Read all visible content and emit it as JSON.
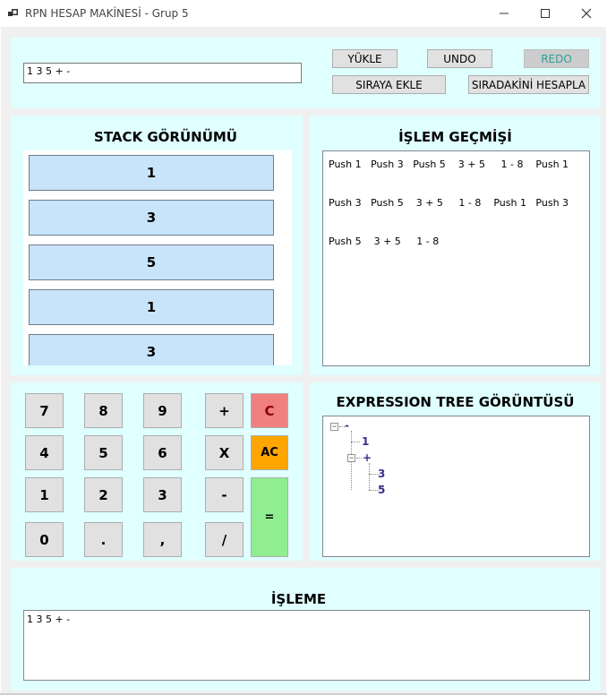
{
  "window": {
    "title": "RPN HESAP MAKİNESİ - Grup 5",
    "icons": {
      "app": "app-icon",
      "minimize": "minimize-icon",
      "maximize": "maximize-icon",
      "close": "close-icon"
    }
  },
  "top": {
    "input_value": "1 3 5 + -",
    "buttons": {
      "load": "YÜKLE",
      "undo": "UNDO",
      "redo": "REDO",
      "enqueue": "SIRAYA EKLE",
      "compute_next": "SIRADAKİNİ HESAPLA"
    }
  },
  "stack": {
    "title": "STACK GÖRÜNÜMÜ",
    "items": [
      "1",
      "3",
      "5",
      "1",
      "3"
    ]
  },
  "history": {
    "title": "İŞLEM GEÇMİŞİ",
    "lines": [
      "Push 1   Push 3   Push 5    3 + 5     1 - 8    Push 1",
      "Push 3   Push 5    3 + 5     1 - 8    Push 1   Push 3",
      "Push 5    3 + 5     1 - 8"
    ]
  },
  "keypad": {
    "keys": {
      "k7": "7",
      "k8": "8",
      "k9": "9",
      "plus": "+",
      "clear": "C",
      "k4": "4",
      "k5": "5",
      "k6": "6",
      "multiply": "X",
      "all_clear": "AC",
      "k1": "1",
      "k2": "2",
      "k3": "3",
      "minus": "-",
      "equals": "=",
      "k0": "0",
      "dot": ".",
      "comma": ",",
      "divide": "/"
    },
    "colors": {
      "clear": "#f08080",
      "all_clear": "#ffa500",
      "equals": "#90ee90"
    }
  },
  "tree": {
    "title": "EXPRESSION TREE GÖRÜNTÜSÜ",
    "root": "-",
    "left_leaf": "1",
    "op_node": "+",
    "op_children": [
      "3",
      "5"
    ]
  },
  "result": {
    "title": "İŞLEME",
    "value": "1 3 5 + -"
  },
  "colors": {
    "panel_bg": "#e0ffff",
    "stack_item_bg": "#c8e4fb",
    "window_bg": "#f0f0f0"
  }
}
